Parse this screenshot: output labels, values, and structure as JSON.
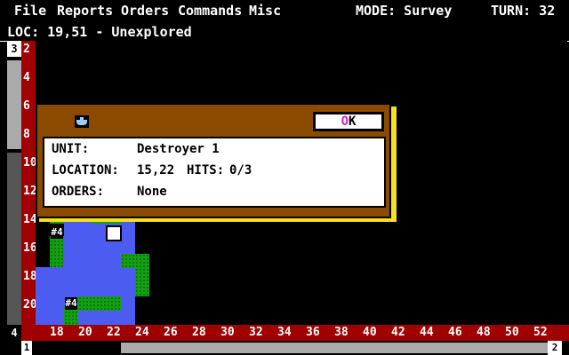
{
  "menu": {
    "file": "File",
    "reports": "Reports",
    "orders": "Orders",
    "commands": "Commands",
    "misc": "Misc"
  },
  "status": {
    "mode": "MODE: Survey",
    "turn": "TURN: 32"
  },
  "location_bar": "LOC: 19,51 - Unexplored",
  "left_scroll_label": "3",
  "y_ruler": [
    "2",
    "4",
    "6",
    "8",
    "10",
    "12",
    "14",
    "16",
    "18",
    "20"
  ],
  "x_ruler": [
    "18",
    "20",
    "22",
    "24",
    "26",
    "28",
    "30",
    "32",
    "34",
    "36",
    "38",
    "40",
    "42",
    "44",
    "46",
    "48",
    "50",
    "52"
  ],
  "corner_label": "4",
  "hscroll_left_label": "1",
  "hscroll_right_label": "2",
  "map": {
    "city_label": "#4",
    "colors": {
      "water": "#4c5cf0",
      "land": "#14a014",
      "ruler": "#a00000"
    }
  },
  "dialog": {
    "icon": "ship-icon",
    "ok_hotkey": "O",
    "ok_rest": "K",
    "unit_label": "UNIT:",
    "unit_value": "Destroyer 1",
    "location_label": "LOCATION:",
    "location_value": "15,22",
    "hits_label": "HITS:",
    "hits_value": "0/3",
    "orders_label": "ORDERS:",
    "orders_value": "None"
  }
}
